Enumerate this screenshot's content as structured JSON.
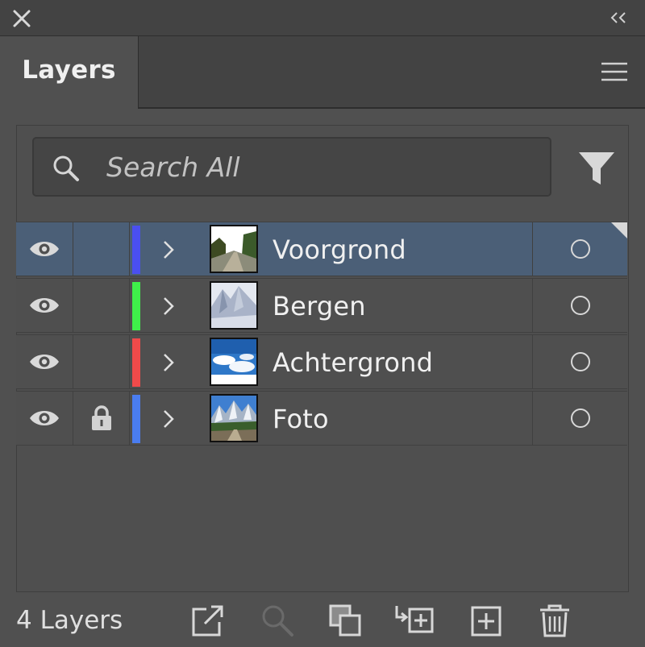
{
  "panel": {
    "tab_label": "Layers"
  },
  "search": {
    "placeholder": "Search All",
    "value": ""
  },
  "layers": [
    {
      "name": "Voorgrond",
      "color": "#4a4ff0",
      "visible": true,
      "locked": false,
      "selected": true
    },
    {
      "name": "Bergen",
      "color": "#3ff04a",
      "visible": true,
      "locked": false,
      "selected": false
    },
    {
      "name": "Achtergrond",
      "color": "#f04a4a",
      "visible": true,
      "locked": false,
      "selected": false
    },
    {
      "name": "Foto",
      "color": "#4a7df0",
      "visible": true,
      "locked": true,
      "selected": false
    }
  ],
  "footer": {
    "count_label": "4 Layers"
  },
  "colors": {
    "selected_row": "#4b5f77",
    "panel_bg": "#505050",
    "header_bg": "#434343"
  }
}
